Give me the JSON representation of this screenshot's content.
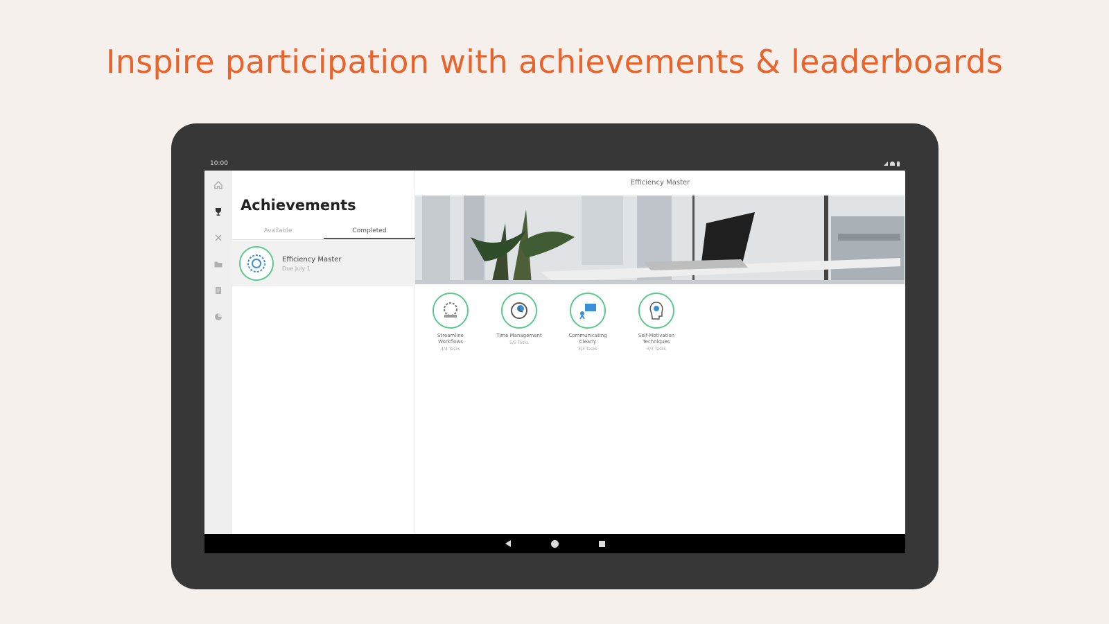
{
  "headline": "Inspire participation with achievements & leaderboards",
  "status_bar": {
    "time": "10:00"
  },
  "sidebar": {
    "items": [
      {
        "icon": "home-icon"
      },
      {
        "icon": "trophy-icon",
        "active": true
      },
      {
        "icon": "close-icon"
      },
      {
        "icon": "folder-icon"
      },
      {
        "icon": "document-icon"
      },
      {
        "icon": "chart-icon"
      }
    ]
  },
  "achievements": {
    "title": "Achievements",
    "tabs": [
      {
        "label": "Available"
      },
      {
        "label": "Completed",
        "active": true
      }
    ],
    "list": [
      {
        "name": "Efficiency Master",
        "subtitle": "Due July 1"
      }
    ]
  },
  "detail": {
    "title": "Efficiency Master",
    "badges": [
      {
        "label": "Streamline Workflows",
        "sub": "4/4 Tasks"
      },
      {
        "label": "Time Management",
        "sub": "5/5 Tasks"
      },
      {
        "label": "Communicating Clearly",
        "sub": "3/3 Tasks"
      },
      {
        "label": "Self-Motivation Techniques",
        "sub": "3/3 Tasks"
      }
    ]
  },
  "colors": {
    "headline": "#e8642c",
    "badge_ring": "#5cc98c",
    "tablet_frame": "#373737",
    "background": "#f5f0eb"
  }
}
